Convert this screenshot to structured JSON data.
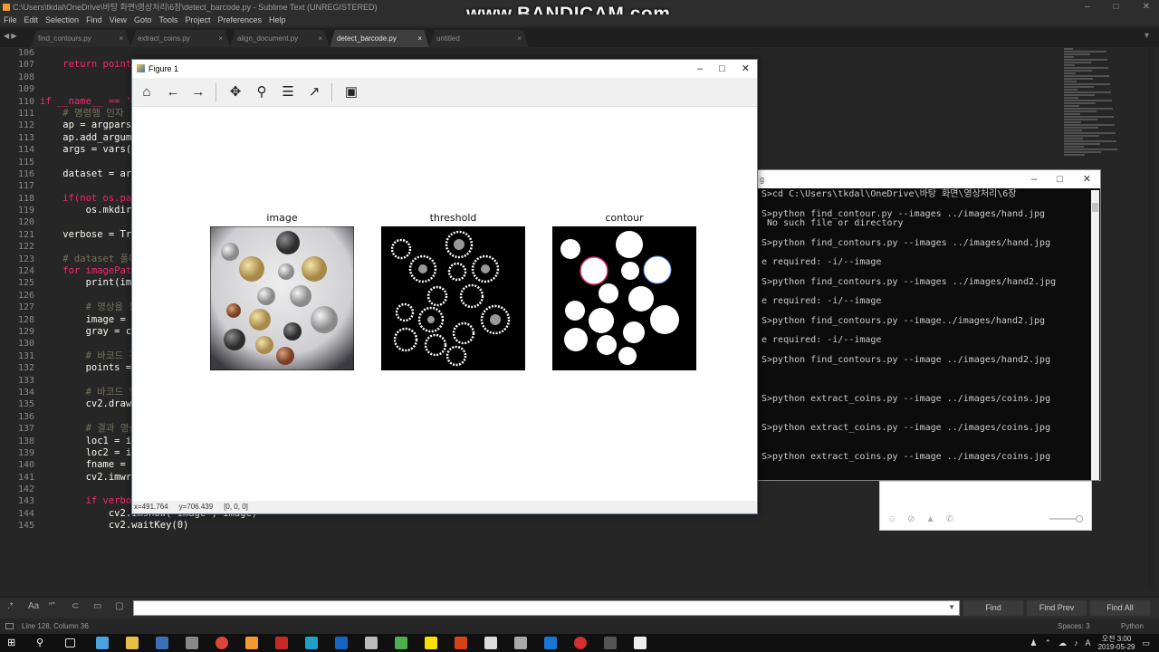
{
  "window": {
    "title": "C:\\Users\\tkdal\\OneDrive\\바탕 화면\\영상처리\\6장\\detect_barcode.py - Sublime Text (UNREGISTERED)",
    "controls": [
      "–",
      "□",
      "✕"
    ]
  },
  "watermark": "www.BANDICAM.com",
  "menu": [
    "File",
    "Edit",
    "Selection",
    "Find",
    "View",
    "Goto",
    "Tools",
    "Project",
    "Preferences",
    "Help"
  ],
  "tabs": [
    {
      "label": "find_contours.py",
      "active": false
    },
    {
      "label": "extract_coins.py",
      "active": false
    },
    {
      "label": "align_document.py",
      "active": false
    },
    {
      "label": "detect_barcode.py",
      "active": true
    },
    {
      "label": "untitled",
      "active": false
    }
  ],
  "tab_close": "×",
  "tab_nav": "◀ ▶",
  "editor": {
    "line_numbers": [
      "106",
      "107",
      "108",
      "109",
      "110",
      "111",
      "112",
      "113",
      "114",
      "115",
      "116",
      "117",
      "118",
      "119",
      "120",
      "121",
      "122",
      "123",
      "124",
      "125",
      "126",
      "127",
      "128",
      "129",
      "130",
      "131",
      "132",
      "133",
      "134",
      "135",
      "136",
      "137",
      "138",
      "139",
      "140",
      "141",
      "142",
      "143",
      "144",
      "145"
    ],
    "lines": [
      "",
      "    return points",
      "",
      "",
      "if __name__ == '",
      "    # 명령행 인자",
      "    ap = argparse",
      "    ap.add_argume",
      "    args = vars(a",
      "",
      "    dataset = arg",
      "",
      "    if(not os.pat",
      "        os.mkdir('",
      "",
      "    verbose = Tru",
      "",
      "    # dataset 폴더",
      "    for imagePath",
      "        print(imag",
      "",
      "        # 영상을 불",
      "        image = cv",
      "        gray = cv2",
      "",
      "        # 바코드 검",
      "        points = d",
      "",
      "        # 바코드 영",
      "        cv2.drawCo",
      "",
      "        # 결과 영상",
      "        loc1 = ima",
      "        loc2 = ima",
      "        fname = 'r",
      "        cv2.imwrit",
      "",
      "        if verbose",
      "            cv2.imshow('image', image)",
      "            cv2.waitKey(0)"
    ]
  },
  "figure": {
    "title": "Figure 1",
    "toolbar": [
      "home-icon",
      "back-icon",
      "forward-icon",
      "pan-icon",
      "zoom-icon",
      "configure-icon",
      "edit-axes-icon",
      "save-icon"
    ],
    "subplots": [
      {
        "label": "image"
      },
      {
        "label": "threshold"
      },
      {
        "label": "contour"
      }
    ],
    "status": {
      "x": "x=491.764",
      "y": "y=706.439",
      "value": "[0, 0, 0]"
    }
  },
  "console": {
    "title": "g",
    "lines": [
      "S>cd C:\\Users\\tkdal\\OneDrive\\바탕 화면\\영상처리\\6장",
      "",
      "S>python find_contour.py --images ../images/hand.jpg",
      " No such file or directory",
      "",
      "S>python find_contours.py --images ../images/hand.jpg",
      "",
      "e required: -i/--image",
      "",
      "S>python find_contours.py --images ../images/hand2.jpg",
      "",
      "e required: -i/--image",
      "",
      "S>python find_contours.py --image../images/hand2.jpg",
      "",
      "e required: -i/--image",
      "",
      "S>python find_contours.py --image ../images/hand2.jpg",
      "",
      "",
      "",
      "S>python extract_coins.py --image ../images/coins.jpg",
      "",
      "",
      "S>python extract_coins.py --image ../images/coins.jpg",
      "",
      "",
      "S>python extract_coins.py --image ../images/coins.jpg"
    ]
  },
  "findbar": {
    "options": [
      ".*",
      "Aa",
      "“”"
    ],
    "find": "Find",
    "find_prev": "Find Prev",
    "find_all": "Find All",
    "dropdown": "▼"
  },
  "status": {
    "position": "Line 128, Column 36",
    "spaces": "Spaces: 3",
    "syntax": "Python"
  },
  "tray": {
    "time": "오전 3:00",
    "date": "2019-05-29"
  }
}
